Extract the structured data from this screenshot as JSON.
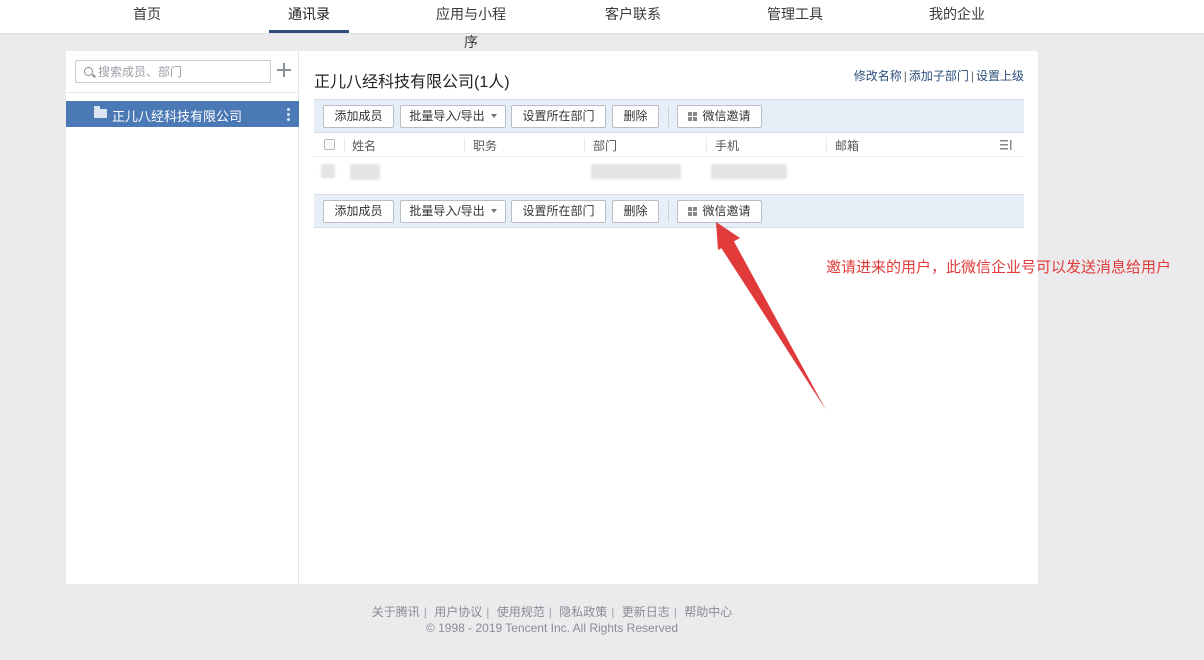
{
  "nav": {
    "items": [
      "首页",
      "通讯录",
      "应用与小程序",
      "客户联系",
      "管理工具",
      "我的企业"
    ],
    "active_index": 1
  },
  "sidebar": {
    "search_placeholder": "搜索成员、部门",
    "tree_root": "正儿八经科技有限公司"
  },
  "content": {
    "title": "正儿八经科技有限公司(1人)",
    "links": [
      "修改名称",
      "添加子部门",
      "设置上级"
    ],
    "toolbar": {
      "add_member": "添加成员",
      "batch_import_export": "批量导入/导出",
      "set_department": "设置所在部门",
      "delete": "删除",
      "wechat_invite": "微信邀请"
    },
    "table": {
      "columns": [
        "姓名",
        "职务",
        "部门",
        "手机",
        "邮箱"
      ]
    }
  },
  "annotation": {
    "text": "邀请进来的用户，此微信企业号可以发送消息给用户",
    "color": "#e03a3a"
  },
  "footer": {
    "links": [
      "关于腾讯",
      "用户协议",
      "使用规范",
      "隐私政策",
      "更新日志",
      "帮助中心"
    ],
    "copyright": "© 1998 - 2019 Tencent Inc. All Rights Reserved"
  }
}
